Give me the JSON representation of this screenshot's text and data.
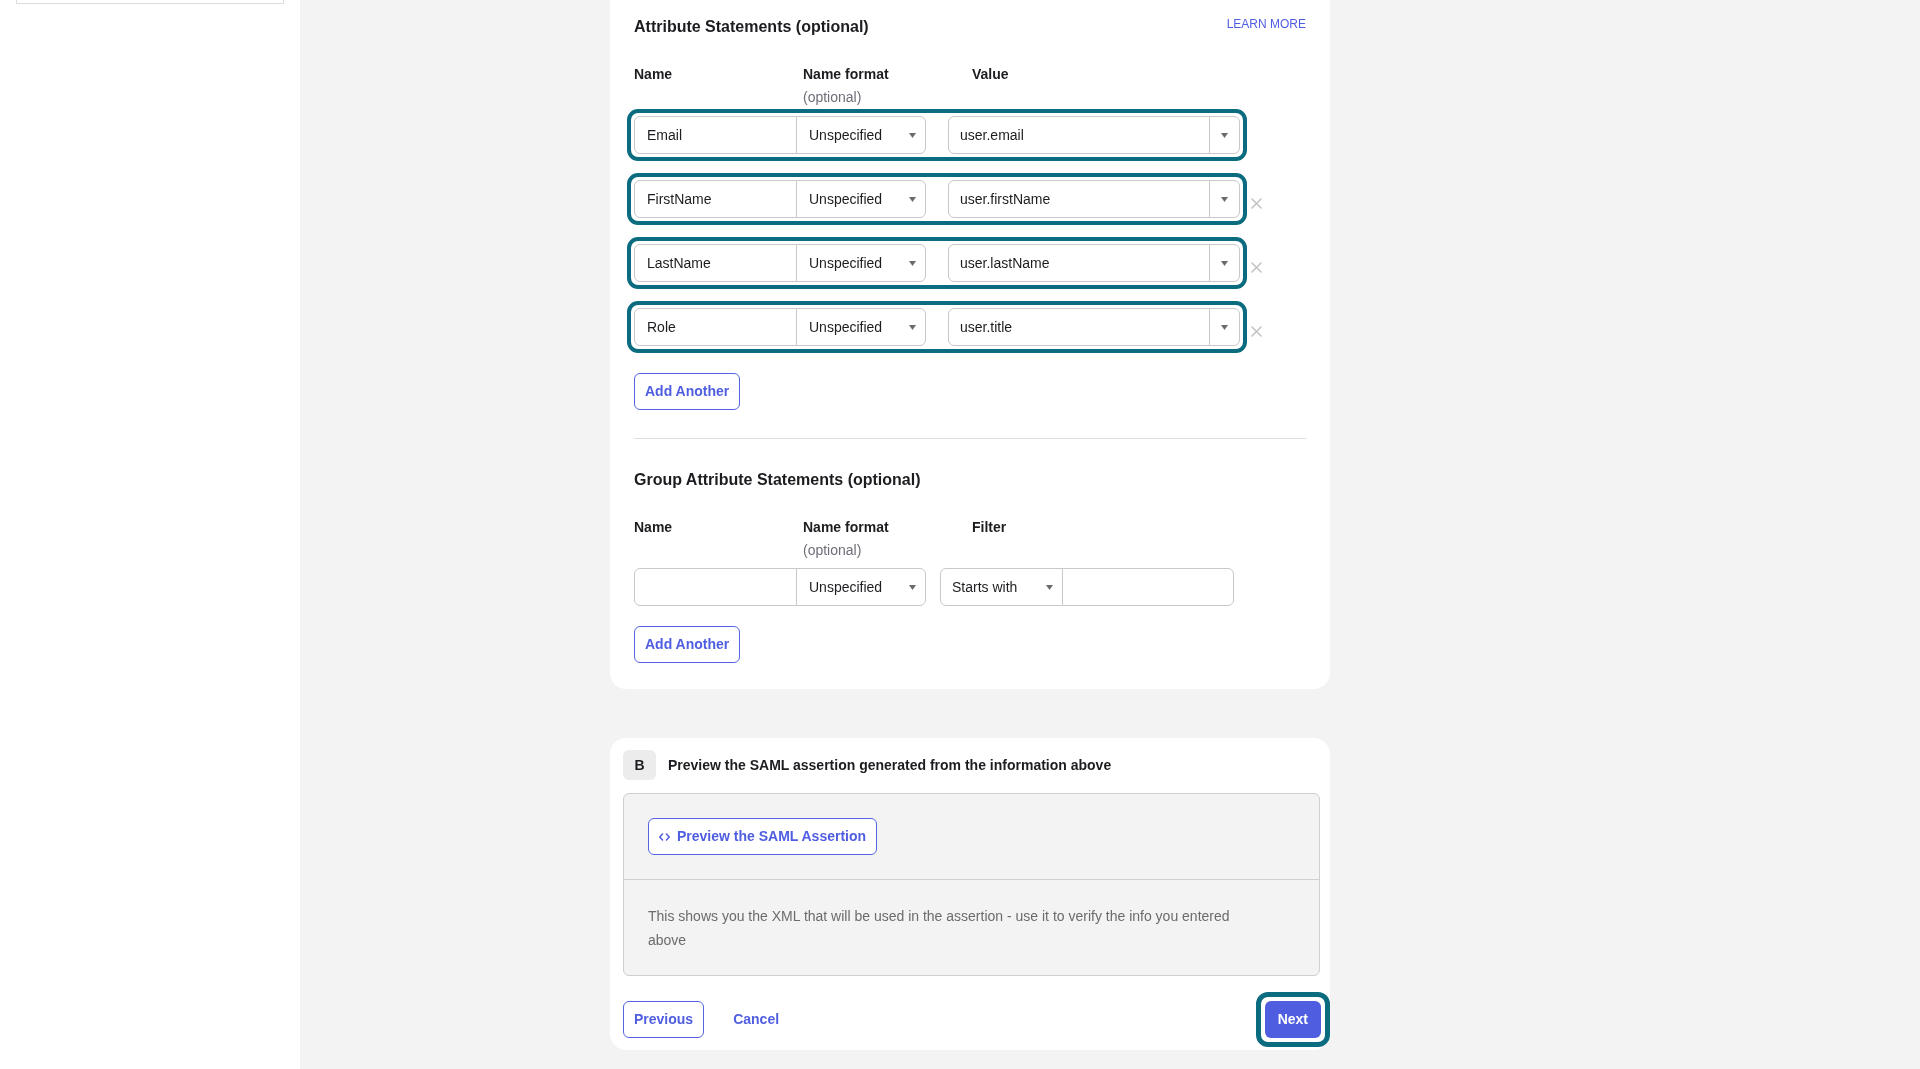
{
  "attribute_statements": {
    "title": "Attribute Statements (optional)",
    "learn_more": "LEARN MORE",
    "columns": [
      {
        "label": "Name"
      },
      {
        "label": "Name format",
        "note": "(optional)"
      },
      {
        "label": "Value"
      }
    ],
    "rows": [
      {
        "name": "Email",
        "name_format": "Unspecified",
        "value": "user.email",
        "removable": false,
        "highlighted": true
      },
      {
        "name": "FirstName",
        "name_format": "Unspecified",
        "value": "user.firstName",
        "removable": true,
        "highlighted": true
      },
      {
        "name": "LastName",
        "name_format": "Unspecified",
        "value": "user.lastName",
        "removable": true,
        "highlighted": true
      },
      {
        "name": "Role",
        "name_format": "Unspecified",
        "value": "user.title",
        "removable": true,
        "highlighted": true
      }
    ],
    "add_button": "Add Another"
  },
  "group_attribute_statements": {
    "title": "Group Attribute Statements (optional)",
    "columns": [
      {
        "label": "Name"
      },
      {
        "label": "Name format",
        "note": "(optional)"
      },
      {
        "label": "Filter"
      }
    ],
    "rows": [
      {
        "name_format": "Unspecified",
        "filter": "Starts with"
      }
    ],
    "add_button": "Add Another"
  },
  "preview": {
    "step": "B",
    "title": "Preview the SAML assertion generated from the information above",
    "button": "Preview the SAML Assertion",
    "description": "This shows you the XML that will be used in the assertion - use it to verify the info you entered above"
  },
  "footer": {
    "previous": "Previous",
    "cancel": "Cancel",
    "next": {
      "label": "Next",
      "highlighted": true
    }
  }
}
